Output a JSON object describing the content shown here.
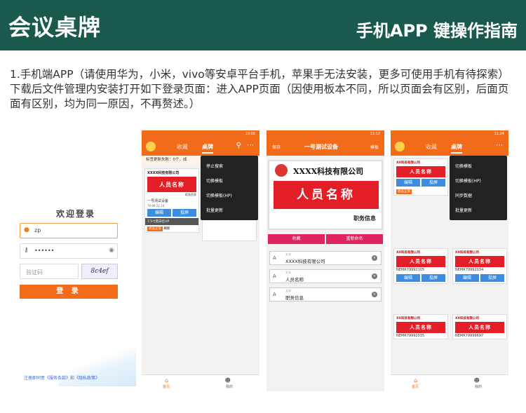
{
  "header": {
    "title_left": "会议桌牌",
    "title_right": "手机APP 键操作指南"
  },
  "intro": "1.手机端APP（请使用华为，小米，vivo等安卓平台手机，苹果手无法安装，更多可使用手机有待探索）下载后文件管理内安装打开如下登录页面：进入APP页面（因使用板本不同，所以页面会有区别，后面页面有区别，均为同一原因，不再赘述。）",
  "login": {
    "welcome": "欢迎登录",
    "username": "zp",
    "password": "••••••",
    "captcha_placeholder": "验证码",
    "captcha_text": "8c4ef",
    "login_button": "登 录",
    "terms": "注册即同意《服务条款》和《隐私政策》"
  },
  "phone2": {
    "status": "10:02",
    "tab_1": "收藏",
    "tab_2": "桌牌",
    "notice": "标签更新失败：0个，成",
    "card": {
      "company": "XXXX科技有限公司",
      "name": "人员名称",
      "position": "职务信息",
      "device": "一号测试设备",
      "mac": "79.99.22.14",
      "edit": "编辑",
      "cast": "投屏",
      "model": "7.5寸黑白红HP",
      "state": "状态正常",
      "state2": "刷新"
    },
    "menu": [
      "停止搜索",
      "切换模板",
      "切换模板(HP)",
      "批量更新"
    ],
    "nav_home": "首页",
    "nav_mine": "我的"
  },
  "phone3": {
    "status": "11:12",
    "save": "保存",
    "title": "一号测试设备",
    "template": "模板",
    "company": "XXXX科技有限公司",
    "name": "人员名称",
    "position": "职务信息",
    "fav": "收藏",
    "rename": "重新命名",
    "field_label": "文本",
    "fields": [
      "XXXX科技有限公司",
      "人员名称",
      "职务信息"
    ]
  },
  "phone4": {
    "status": "11:24",
    "tab_1": "收藏",
    "tab_2": "桌牌",
    "menu": [
      "切换模板",
      "切换模板(HP)",
      "同步数据",
      "批量更新"
    ],
    "company": "XX科技有限公司",
    "name": "人员名称",
    "devices": [
      "NEMR79992105",
      "NEMR79992034",
      "NEMR79992035",
      "NEMR79999697"
    ],
    "edit": "编辑",
    "cast": "投屏",
    "state": "状态正常",
    "nav_home": "首页",
    "nav_mine": "我的"
  }
}
